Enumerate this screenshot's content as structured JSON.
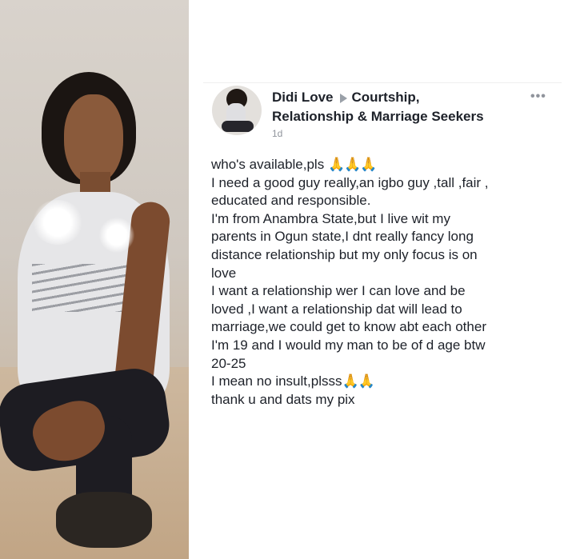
{
  "post": {
    "author": "Didi Love",
    "group_line1": "Courtship,",
    "group_line2": "Relationship & Marriage Seekers",
    "timestamp": "1d",
    "more_label": "•••",
    "lines": [
      "who's available,pls",
      "I need a good guy really,an igbo guy ,tall ,fair ,",
      "educated and responsible.",
      "I'm from Anambra State,but I live wit my",
      "parents in Ogun state,I dnt really fancy long",
      "distance relationship but my only focus is on",
      "love",
      "I want a relationship wer I can love and be",
      "loved ,I want a relationship dat will lead to",
      "marriage,we could get to know abt each other",
      "I'm 19 and I would my man to be of d age btw",
      "20-25",
      "I mean no insult,plsss",
      "thank u and dats my pix"
    ],
    "emoji_line0": "🙏🙏🙏",
    "emoji_line12": "🙏🙏"
  },
  "colors": {
    "text": "#1d2129",
    "meta": "#90949c"
  },
  "icons": {
    "group_arrow": "right-triangle-icon",
    "more": "more-options-icon",
    "emoji": "praying-hands-icon"
  }
}
